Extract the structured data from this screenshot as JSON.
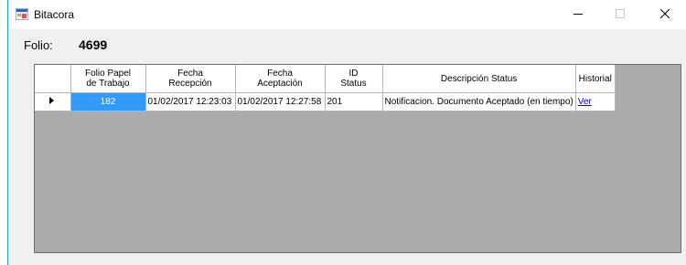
{
  "window": {
    "title": "Bitacora",
    "icon": "app-form-icon",
    "controls": [
      "minimize-icon",
      "maximize-icon",
      "close-icon"
    ]
  },
  "folio": {
    "label": "Folio:",
    "value": "4699"
  },
  "grid": {
    "columns": [
      "Folio Papel\nde Trabajo",
      "Fecha\nRecepción",
      "Fecha\nAceptación",
      "ID\nStatus",
      "Descripción Status",
      "Historial"
    ],
    "rows": [
      {
        "folio": "182",
        "recepcion": "01/02/2017 12:23:03",
        "aceptacion": "01/02/2017 12:27:58",
        "id_status": "201",
        "descripcion": "Notificacion. Documento Aceptado (en tiempo)",
        "historial": "Ver"
      }
    ],
    "colors": {
      "selected": "#3399ff",
      "empty_area": "#ababab",
      "link": "#0000ff"
    }
  }
}
